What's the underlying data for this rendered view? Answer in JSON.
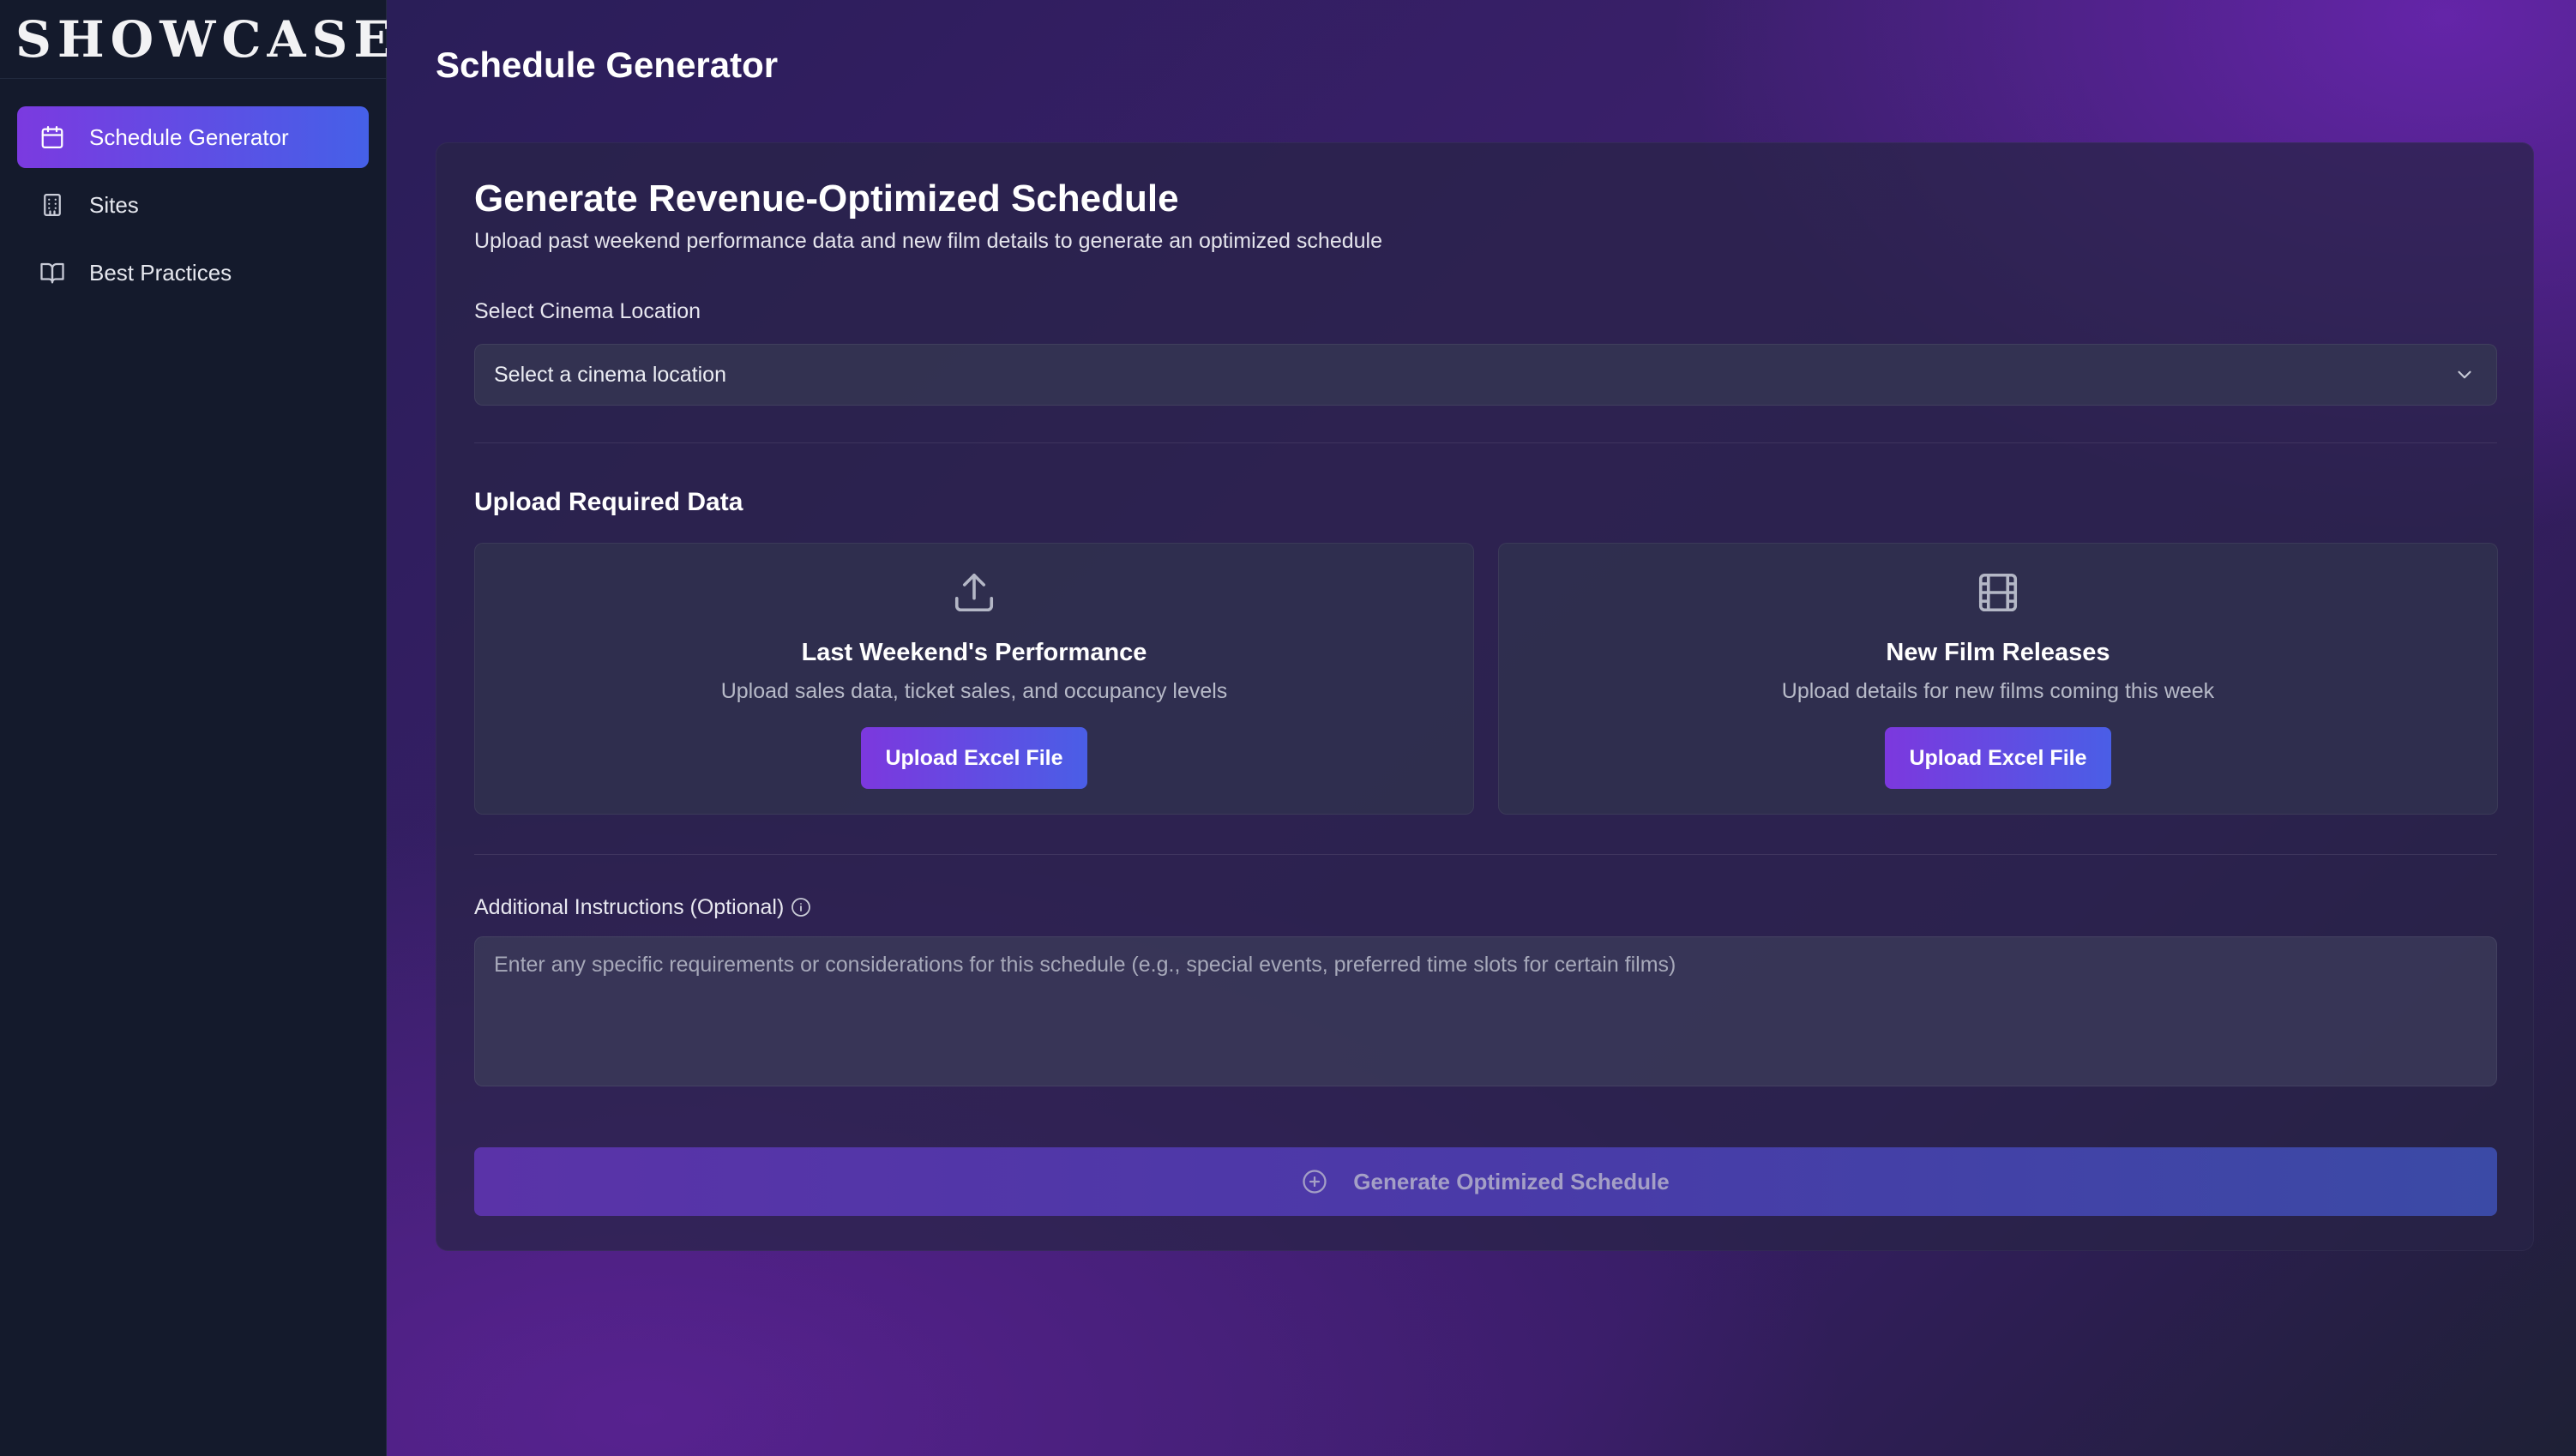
{
  "brand": {
    "logo_text": "SHOWCASE"
  },
  "sidebar": {
    "items": [
      {
        "label": "Schedule Generator",
        "icon": "calendar-icon",
        "active": true
      },
      {
        "label": "Sites",
        "icon": "building-icon",
        "active": false
      },
      {
        "label": "Best Practices",
        "icon": "book-open-icon",
        "active": false
      }
    ]
  },
  "header": {
    "title": "Schedule Generator"
  },
  "form": {
    "title": "Generate Revenue-Optimized Schedule",
    "subtitle": "Upload past weekend performance data and new film details to generate an optimized schedule",
    "location_label": "Select Cinema Location",
    "location_value": "Select a cinema location",
    "upload_section_title": "Upload Required Data",
    "uploads": [
      {
        "icon": "upload-icon",
        "title": "Last Weekend's Performance",
        "description": "Upload sales data, ticket sales, and occupancy levels",
        "button_label": "Upload Excel File"
      },
      {
        "icon": "film-icon",
        "title": "New Film Releases",
        "description": "Upload details for new films coming this week",
        "button_label": "Upload Excel File"
      }
    ],
    "instructions_label": "Additional Instructions (Optional)",
    "instructions_placeholder": "Enter any specific requirements or considerations for this schedule (e.g., special events, preferred time slots for certain films)",
    "generate_button_label": "Generate Optimized Schedule"
  },
  "colors": {
    "accent_start": "#7c38de",
    "accent_end": "#4a5ee6",
    "sidebar_bg": "#141a2c"
  }
}
